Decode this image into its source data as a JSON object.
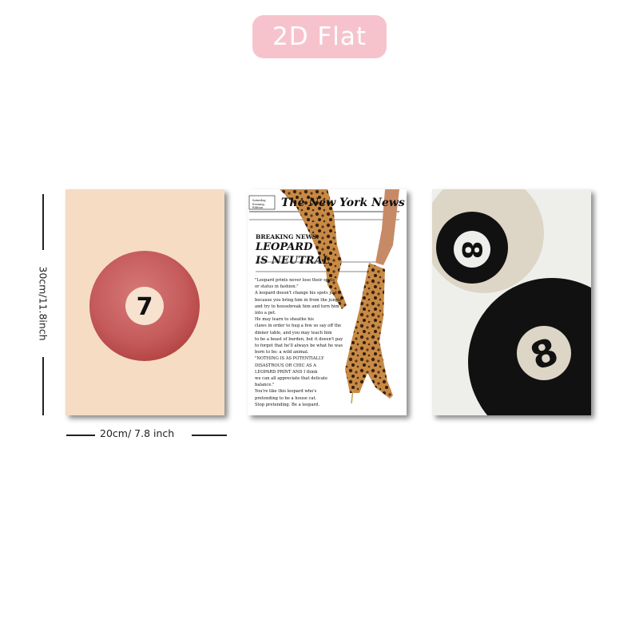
{
  "badge": {
    "label": "2D Flat"
  },
  "dimensions": {
    "height_label": "30cm/11.8inch",
    "width_label": "20cm/ 7.8 inch"
  },
  "prints": [
    {
      "name": "pool-ball-7",
      "ball_number": "7",
      "background": "#f6dcc3",
      "ball_color": "#c45a5a"
    },
    {
      "name": "leopard-newspaper",
      "masthead": "The New York News",
      "masthead_box": "Saturday, Evening Edition",
      "kicker": "BREAKING NEWS:",
      "headline_line1": "LEOPARD",
      "headline_line2": "IS NEUTRAL",
      "body_lines": [
        "\"Leopard prints never lose their spots",
        "or status in fashion.\"",
        "A leopard doesn't change his spots just",
        "because you bring him in from the jungle",
        "and try to housebreak him and turn him",
        "into a pet.",
        "He may learn to sheathe his",
        "claws in order to hug a few so say off the",
        "dinner table, and you may teach him",
        "to be a beast of burden, but it doesn't pay",
        "to forget that he'll always be what he was",
        "born to be: a wild animal.",
        "\"NOTHING IS AS POTENTIALLY",
        "DISASTROUS OR CHIC AS A",
        "LEOPARD PRINT AND I think",
        "we can all appreciate that delicate",
        "balance.\"",
        "You're like this leopard who's",
        "pretending to be a house cat.",
        "Stop pretending. Be a leopard."
      ]
    },
    {
      "name": "pool-ball-8",
      "ball_number_top": "8",
      "ball_number_bottom": "8",
      "background": "#eeeeeb",
      "accent": "#ddd5c5"
    }
  ]
}
